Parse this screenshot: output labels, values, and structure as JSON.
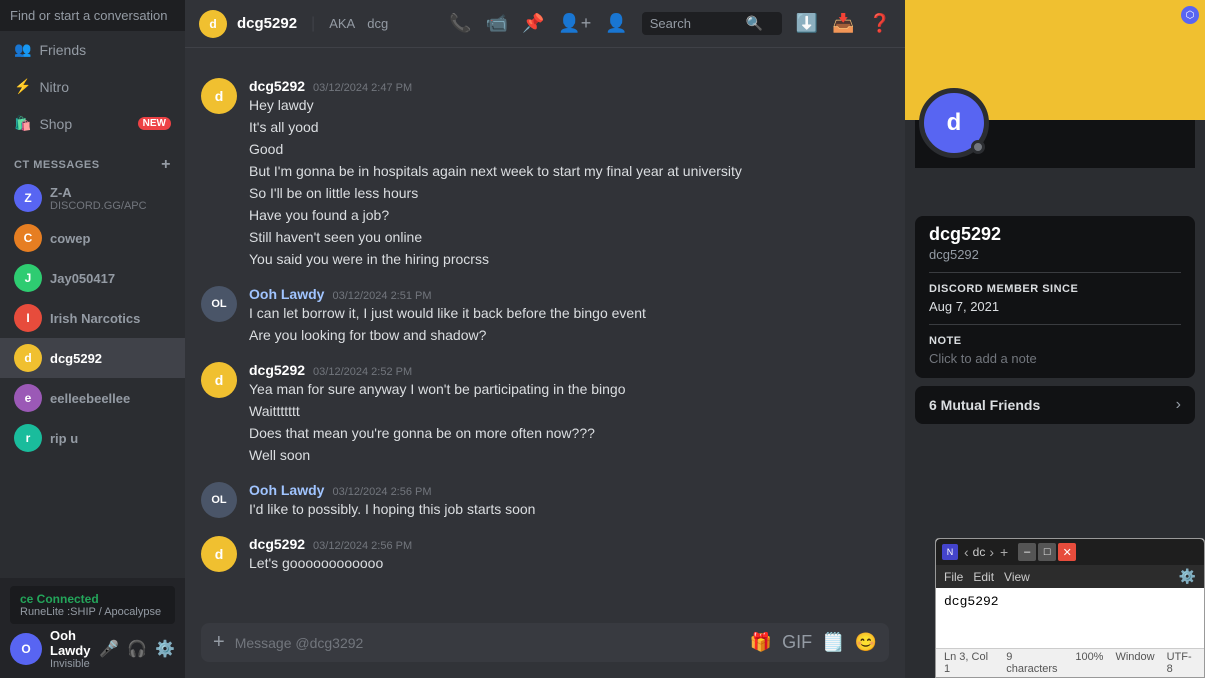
{
  "sidebar": {
    "search_placeholder": "Find or start a conversation",
    "nav_items": [
      {
        "id": "friends",
        "label": "Friends"
      },
      {
        "id": "nitro",
        "label": "Nitro"
      },
      {
        "id": "shop",
        "label": "Shop",
        "badge": "NEW"
      }
    ],
    "section_label": "CT MESSAGES",
    "dm_list": [
      {
        "id": "z-a",
        "name": "Z-A",
        "sub": "DISCORD.GG/APC",
        "color": "#5865f2",
        "initials": "Z"
      },
      {
        "id": "cowep",
        "name": "cowep",
        "sub": "",
        "color": "#e67e22",
        "initials": "C"
      },
      {
        "id": "jay050417",
        "name": "Jay050417",
        "sub": "",
        "color": "#2ecc71",
        "initials": "J"
      },
      {
        "id": "irish-narcotics",
        "name": "Irish Narcotics",
        "sub": "",
        "color": "#e74c3c",
        "initials": "I"
      },
      {
        "id": "dcg5292",
        "name": "dcg5292",
        "sub": "",
        "color": "#f0c030",
        "initials": "d",
        "active": true
      },
      {
        "id": "eelleebeellee",
        "name": "eelleebeellee",
        "sub": "",
        "color": "#9b59b6",
        "initials": "e"
      },
      {
        "id": "rip-u",
        "name": "rip u",
        "sub": "",
        "color": "#1abc9c",
        "initials": "r"
      }
    ],
    "voice_section": {
      "app_name": "RuneLite",
      "connected_label": "ce Connected",
      "server": ":SHIP / Apocalypse"
    },
    "user": {
      "name": "Ooh Lawdy",
      "status": "Invisible"
    }
  },
  "chat_header": {
    "avatar_initials": "d",
    "avatar_color": "#f0c030",
    "username": "dcg5292",
    "aka_label": "AKA",
    "aka_value": "dcg",
    "search_placeholder": "Search",
    "icons": [
      "phone",
      "video",
      "pin",
      "add-friend",
      "profile"
    ]
  },
  "messages": [
    {
      "id": "msg1",
      "author": "dcg5292",
      "author_type": "dcg",
      "avatar_color": "#f0c030",
      "avatar_initials": "d",
      "timestamp": "03/12/2024 2:47 PM",
      "lines": [
        "Hey lawdy",
        "It's all yood",
        "Good",
        "But I'm gonna be in hospitals again next week to start my final year at university",
        "So I'll be on little less hours",
        "Have you found a job?",
        "Still haven't seen you online",
        "You said you were in the hiring procrss"
      ]
    },
    {
      "id": "msg2",
      "author": "Ooh Lawdy",
      "author_type": "ooh",
      "avatar_color": "#4a5568",
      "avatar_initials": "OL",
      "avatar_img": true,
      "timestamp": "03/12/2024 2:51 PM",
      "lines": [
        "I can let borrow it, I just would like it back before the bingo event",
        "Are you looking for tbow and shadow?"
      ]
    },
    {
      "id": "msg3",
      "author": "dcg5292",
      "author_type": "dcg",
      "avatar_color": "#f0c030",
      "avatar_initials": "d",
      "timestamp": "03/12/2024 2:52 PM",
      "lines": [
        "Yea man for sure anyway I won't be participating in the bingo",
        "Waittttttt",
        "Does that mean you're gonna be on more often now???",
        "Well soon"
      ]
    },
    {
      "id": "msg4",
      "author": "Ooh Lawdy",
      "author_type": "ooh",
      "avatar_color": "#4a5568",
      "avatar_initials": "OL",
      "avatar_img": true,
      "timestamp": "03/12/2024 2:56 PM",
      "lines": [
        "I'd like to possibly. I hoping this job starts soon"
      ]
    },
    {
      "id": "msg5",
      "author": "dcg5292",
      "author_type": "dcg",
      "avatar_color": "#f0c030",
      "avatar_initials": "d",
      "timestamp": "03/12/2024 2:56 PM",
      "lines": [
        "Let's goooooooooooo"
      ]
    }
  ],
  "input": {
    "placeholder": "Message @dcg3292"
  },
  "profile": {
    "banner_color": "#f0c030",
    "username": "dcg5292",
    "handle": "dcg5292",
    "discord_member_since_label": "DISCORD MEMBER SINCE",
    "member_since": "Aug 7, 2021",
    "note_label": "NOTE",
    "note_placeholder": "Click to add a note",
    "mutual_friends_label": "6 Mutual Friends"
  },
  "notepad": {
    "title": "dc",
    "menu_items": [
      "File",
      "Edit",
      "View"
    ],
    "content": "dcg5292",
    "status": {
      "ln": "Ln 3, Col 1",
      "chars": "9 characters",
      "zoom": "100%",
      "window": "Window",
      "encoding": "UTF-8"
    }
  }
}
